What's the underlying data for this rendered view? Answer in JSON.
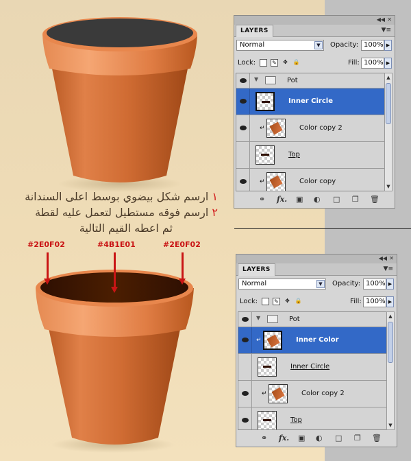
{
  "colors": {
    "pot_orange": "#D8743F",
    "pot_dark": "#A94E1A",
    "inner_dark": "#2E0F02",
    "inner_mid": "#4B1E01",
    "selection_blue": "#3369C7",
    "arrow_red": "#C91515"
  },
  "instructions": {
    "line1_num": "١",
    "line1_text": "ارسم شكل بيضوي بوسط اعلى السندانة",
    "line2_num": "٢",
    "line2_text": "ارسم فوقه مستطيل لتعمل عليه لقطة",
    "line3_text": "ثم اعطه القيم التالية"
  },
  "gradient_labels": {
    "left": "#2E0F02",
    "center": "#4B1E01",
    "right": "#2E0F02"
  },
  "panel_top": {
    "title": "LAYERS",
    "blend_mode": "Normal",
    "opacity_label": "Opacity:",
    "opacity_value": "100%",
    "lock_label": "Lock:",
    "fill_label": "Fill:",
    "fill_value": "100%",
    "layers": [
      {
        "name": "Pot",
        "type": "group",
        "active": false
      },
      {
        "name": "Inner Circle",
        "type": "layer",
        "active": true
      },
      {
        "name": "Color copy 2",
        "type": "clipped",
        "active": false
      },
      {
        "name": "Top",
        "type": "layer",
        "active": false
      },
      {
        "name": "Color copy",
        "type": "clipped",
        "active": false
      }
    ],
    "bottom_icons": [
      "link-icon",
      "fx-icon",
      "mask-icon",
      "adjustment-icon",
      "group-icon",
      "new-layer-icon",
      "trash-icon"
    ],
    "fx_label": "fx."
  },
  "panel_bottom": {
    "title": "LAYERS",
    "blend_mode": "Normal",
    "opacity_label": "Opacity:",
    "opacity_value": "100%",
    "lock_label": "Lock:",
    "fill_label": "Fill:",
    "fill_value": "100%",
    "layers": [
      {
        "name": "Pot",
        "type": "group",
        "active": false
      },
      {
        "name": "Inner Color",
        "type": "clipped",
        "active": true
      },
      {
        "name": "Inner Circle",
        "type": "layer",
        "active": false
      },
      {
        "name": "Color copy 2",
        "type": "clipped",
        "active": false
      },
      {
        "name": "Top",
        "type": "layer",
        "active": false
      }
    ],
    "bottom_icons": [
      "link-icon",
      "fx-icon",
      "mask-icon",
      "adjustment-icon",
      "group-icon",
      "new-layer-icon",
      "trash-icon"
    ],
    "fx_label": "fx."
  }
}
